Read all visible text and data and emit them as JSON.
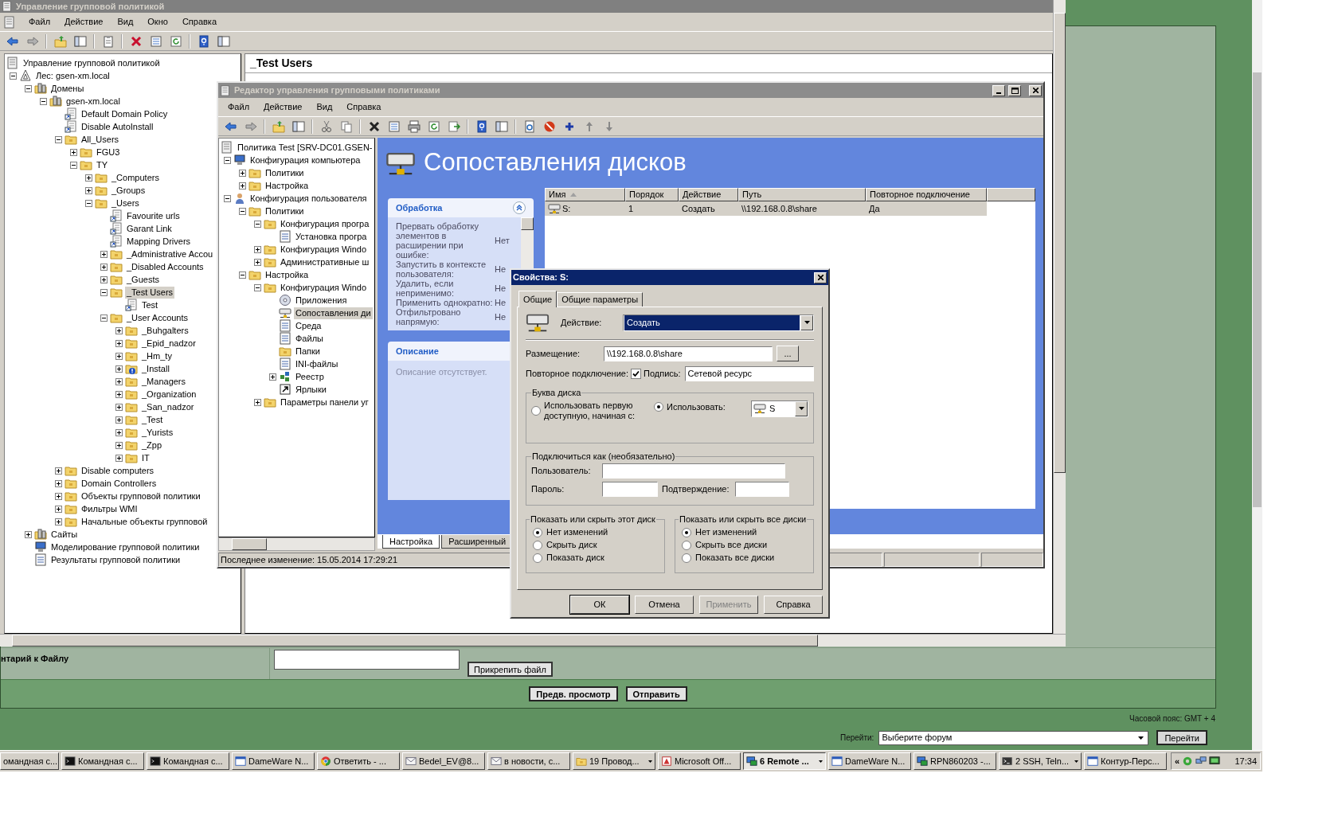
{
  "gpmc": {
    "title": "Управление групповой политикой",
    "menu": [
      "Файл",
      "Действие",
      "Вид",
      "Окно",
      "Справка"
    ],
    "details_title": "_Test Users",
    "tree": [
      {
        "label": "Управление групповой политикой",
        "kind": "console",
        "selected": false,
        "children": [
          {
            "label": "Лес: gsen-xm.local",
            "kind": "forest",
            "expanded": true,
            "selected": false,
            "children": [
              {
                "label": "Домены",
                "kind": "servers",
                "expanded": true,
                "selected": false,
                "children": [
                  {
                    "label": "gsen-xm.local",
                    "kind": "servers",
                    "expanded": true,
                    "selected": false,
                    "children": [
                      {
                        "label": "Default Domain Policy",
                        "kind": "gpo",
                        "selected": false
                      },
                      {
                        "label": "Disable AutoInstall",
                        "kind": "gpo",
                        "selected": false
                      },
                      {
                        "label": "All_Users",
                        "kind": "folder",
                        "expanded": true,
                        "selected": false,
                        "children": [
                          {
                            "label": "FGU3",
                            "kind": "folder",
                            "expanded": false,
                            "selected": false
                          },
                          {
                            "label": "TY",
                            "kind": "folder",
                            "expanded": true,
                            "selected": false,
                            "children": [
                              {
                                "label": "_Computers",
                                "kind": "folder",
                                "expanded": false,
                                "selected": false
                              },
                              {
                                "label": "_Groups",
                                "kind": "folder",
                                "expanded": false,
                                "selected": false
                              },
                              {
                                "label": "_Users",
                                "kind": "folder",
                                "expanded": true,
                                "selected": false,
                                "children": [
                                  {
                                    "label": "Favourite urls",
                                    "kind": "gpo",
                                    "selected": false
                                  },
                                  {
                                    "label": "Garant Link",
                                    "kind": "gpo",
                                    "selected": false
                                  },
                                  {
                                    "label": "Mapping Drivers",
                                    "kind": "gpo",
                                    "selected": false
                                  },
                                  {
                                    "label": "_Administrative Accou",
                                    "kind": "folder",
                                    "expanded": false,
                                    "selected": false
                                  },
                                  {
                                    "label": "_Disabled Accounts",
                                    "kind": "folder",
                                    "expanded": false,
                                    "selected": false
                                  },
                                  {
                                    "label": "_Guests",
                                    "kind": "folder",
                                    "expanded": false,
                                    "selected": false
                                  },
                                  {
                                    "label": "_Test Users",
                                    "kind": "folder",
                                    "expanded": true,
                                    "selected": true,
                                    "children": [
                                      {
                                        "label": "Test",
                                        "kind": "gpo",
                                        "selected": false
                                      }
                                    ]
                                  },
                                  {
                                    "label": "_User Accounts",
                                    "kind": "folder",
                                    "expanded": true,
                                    "selected": false,
                                    "children": [
                                      {
                                        "label": "_Buhgalters",
                                        "kind": "folder",
                                        "expanded": false,
                                        "selected": false
                                      },
                                      {
                                        "label": "_Epid_nadzor",
                                        "kind": "folder",
                                        "expanded": false,
                                        "selected": false
                                      },
                                      {
                                        "label": "_Hm_ty",
                                        "kind": "folder",
                                        "expanded": false,
                                        "selected": false
                                      },
                                      {
                                        "label": "_Install",
                                        "kind": "folder-alert",
                                        "expanded": false,
                                        "selected": false
                                      },
                                      {
                                        "label": "_Managers",
                                        "kind": "folder",
                                        "expanded": false,
                                        "selected": false
                                      },
                                      {
                                        "label": "_Organization",
                                        "kind": "folder",
                                        "expanded": false,
                                        "selected": false
                                      },
                                      {
                                        "label": "_San_nadzor",
                                        "kind": "folder",
                                        "expanded": false,
                                        "selected": false
                                      },
                                      {
                                        "label": "_Test",
                                        "kind": "folder",
                                        "expanded": false,
                                        "selected": false
                                      },
                                      {
                                        "label": "_Yurists",
                                        "kind": "folder",
                                        "expanded": false,
                                        "selected": false
                                      },
                                      {
                                        "label": "_Zpp",
                                        "kind": "folder",
                                        "expanded": false,
                                        "selected": false
                                      },
                                      {
                                        "label": "IT",
                                        "kind": "folder",
                                        "expanded": false,
                                        "selected": false
                                      }
                                    ]
                                  }
                                ]
                              }
                            ]
                          }
                        ]
                      },
                      {
                        "label": "Disable computers",
                        "kind": "folder",
                        "expanded": false,
                        "selected": false
                      },
                      {
                        "label": "Domain Controllers",
                        "kind": "folder",
                        "expanded": false,
                        "selected": false
                      },
                      {
                        "label": "Объекты групповой политики",
                        "kind": "folder",
                        "expanded": false,
                        "selected": false
                      },
                      {
                        "label": "Фильтры WMI",
                        "kind": "folder",
                        "expanded": false,
                        "selected": false
                      },
                      {
                        "label": "Начальные объекты групповой",
                        "kind": "folder",
                        "expanded": false,
                        "selected": false
                      }
                    ]
                  }
                ]
              },
              {
                "label": "Сайты",
                "kind": "servers",
                "expanded": false,
                "selected": false
              },
              {
                "label": "Моделирование групповой политики",
                "kind": "computer",
                "selected": false
              },
              {
                "label": "Результаты групповой политики",
                "kind": "doc",
                "selected": false
              }
            ]
          }
        ]
      }
    ]
  },
  "editor": {
    "title": "Редактор управления групповыми политиками",
    "menu": [
      "Файл",
      "Действие",
      "Вид",
      "Справка"
    ],
    "tree": [
      {
        "label": "Политика Test [SRV-DC01.GSEN-",
        "kind": "console",
        "selected": false,
        "children": [
          {
            "label": "Конфигурация компьютера",
            "kind": "computer",
            "expanded": true,
            "selected": false,
            "children": [
              {
                "label": "Политики",
                "kind": "folder",
                "expanded": false,
                "selected": false
              },
              {
                "label": "Настройка",
                "kind": "folder",
                "expanded": false,
                "selected": false
              }
            ]
          },
          {
            "label": "Конфигурация пользователя",
            "kind": "user",
            "expanded": true,
            "selected": false,
            "children": [
              {
                "label": "Политики",
                "kind": "folder",
                "expanded": true,
                "selected": false,
                "children": [
                  {
                    "label": "Конфигурация програ",
                    "kind": "folder",
                    "expanded": true,
                    "selected": false,
                    "children": [
                      {
                        "label": "Установка програ",
                        "kind": "doc",
                        "selected": false
                      }
                    ]
                  },
                  {
                    "label": "Конфигурация Windo",
                    "kind": "folder",
                    "expanded": false,
                    "selected": false
                  },
                  {
                    "label": "Административные ш",
                    "kind": "folder",
                    "expanded": false,
                    "selected": false
                  }
                ]
              },
              {
                "label": "Настройка",
                "kind": "folder",
                "expanded": true,
                "selected": false,
                "children": [
                  {
                    "label": "Конфигурация Windo",
                    "kind": "folder",
                    "expanded": true,
                    "selected": false,
                    "children": [
                      {
                        "label": "Приложения",
                        "kind": "disc",
                        "selected": false
                      },
                      {
                        "label": "Сопоставления ди",
                        "kind": "drive",
                        "selected": true
                      },
                      {
                        "label": "Среда",
                        "kind": "doc",
                        "selected": false
                      },
                      {
                        "label": "Файлы",
                        "kind": "doc",
                        "selected": false
                      },
                      {
                        "label": "Папки",
                        "kind": "folder",
                        "selected": false
                      },
                      {
                        "label": "INI-файлы",
                        "kind": "doc",
                        "selected": false
                      },
                      {
                        "label": "Реестр",
                        "kind": "registry",
                        "expanded": false,
                        "selected": false
                      },
                      {
                        "label": "Ярлыки",
                        "kind": "shortcut",
                        "selected": false
                      }
                    ]
                  },
                  {
                    "label": "Параметры панели уг",
                    "kind": "folder",
                    "expanded": false,
                    "selected": false
                  }
                ]
              }
            ]
          }
        ]
      }
    ],
    "heading": "Сопоставления дисков",
    "processing": {
      "title": "Обработка",
      "rows": [
        {
          "label": "Прервать обработку элементов в расширении при ошибке:",
          "value": "Нет"
        },
        {
          "label": "Запустить в контексте пользователя:",
          "value": "Не"
        },
        {
          "label": "Удалить, если неприменимо:",
          "value": "Не"
        },
        {
          "label": "Применить однократно:",
          "value": "Не"
        },
        {
          "label": "Отфильтровано напрямую:",
          "value": "Не"
        }
      ]
    },
    "description": {
      "title": "Описание",
      "text": "Описание отсутствует."
    },
    "table": {
      "columns": [
        {
          "label": "Имя",
          "sorted": true
        },
        {
          "label": "Порядок",
          "sorted": false
        },
        {
          "label": "Действие",
          "sorted": false
        },
        {
          "label": "Путь",
          "sorted": false
        },
        {
          "label": "Повторное подключение",
          "sorted": false
        }
      ],
      "rows": [
        {
          "cells": [
            "S:",
            "1",
            "Создать",
            "\\\\192.168.0.8\\share",
            "Да"
          ],
          "selected": true
        }
      ]
    },
    "tabs": [
      {
        "label": "Настройка",
        "selected": true
      },
      {
        "label": "Расширенный",
        "selected": false
      }
    ],
    "status": "Последнее изменение: 15.05.2014 17:29:21"
  },
  "dialog": {
    "title": "Свойства: S:",
    "tabs": [
      {
        "label": "Общие",
        "selected": true
      },
      {
        "label": "Общие параметры",
        "selected": false
      }
    ],
    "action": {
      "label": "Действие:",
      "value": "Создать"
    },
    "location": {
      "label": "Размещение:",
      "value": "\\\\192.168.0.8\\share",
      "browse": "..."
    },
    "reconnect": {
      "label": "Повторное подключение:",
      "checked": true
    },
    "caption": {
      "label": "Подпись:",
      "value": "Сетевой ресурс"
    },
    "drive_letter": {
      "title": "Буква диска",
      "options": [
        {
          "label": "Использовать первую доступную, начиная с:",
          "selected": false
        },
        {
          "label": "Использовать:",
          "selected": true
        }
      ],
      "letter": "S"
    },
    "connect_as": {
      "title": "Подключиться как (необязательно)",
      "user_label": "Пользователь:",
      "password_label": "Пароль:",
      "confirm_label": "Подтверждение:"
    },
    "show_this": {
      "title": "Показать или скрыть этот диск",
      "options": [
        {
          "label": "Нет изменений",
          "selected": true
        },
        {
          "label": "Скрыть диск",
          "selected": false
        },
        {
          "label": "Показать диск",
          "selected": false
        }
      ]
    },
    "show_all": {
      "title": "Показать или скрыть все диски",
      "options": [
        {
          "label": "Нет изменений",
          "selected": true
        },
        {
          "label": "Скрыть все диски",
          "selected": false
        },
        {
          "label": "Показать все диски",
          "selected": false
        }
      ]
    },
    "buttons": [
      {
        "label": "ОК",
        "default": true,
        "disabled": false
      },
      {
        "label": "Отмена",
        "default": false,
        "disabled": false
      },
      {
        "label": "Применить",
        "default": false,
        "disabled": true
      },
      {
        "label": "Справка",
        "default": false,
        "disabled": false
      }
    ]
  },
  "forum": {
    "comment_label": "нтарий к Файлу",
    "attach_button": "Прикрепить файл",
    "buttons": [
      "Предв. просмотр",
      "Отправить"
    ],
    "timezone": "Часовой пояс: GMT + 4",
    "jump_label": "Перейти:",
    "jump_select": "Выберите форум",
    "jump_button": "Перейти"
  },
  "taskbar": {
    "items": [
      {
        "label": "омандная с...",
        "grouped": false,
        "selected": false
      },
      {
        "label": "Командная с...",
        "kind": "console",
        "grouped": false,
        "selected": false
      },
      {
        "label": "Командная с...",
        "kind": "console",
        "grouped": false,
        "selected": false
      },
      {
        "label": "DameWare N...",
        "kind": "window",
        "grouped": false,
        "selected": false
      },
      {
        "label": "Ответить - ...",
        "kind": "browser",
        "grouped": false,
        "selected": false
      },
      {
        "label": "Bedel_EV@8...",
        "kind": "mail",
        "grouped": false,
        "selected": false
      },
      {
        "label": "в новости, с...",
        "kind": "mail",
        "grouped": false,
        "selected": false
      },
      {
        "label": "19 Провод...",
        "kind": "folder",
        "grouped": true,
        "selected": false
      },
      {
        "label": "Microsoft Off...",
        "kind": "office",
        "grouped": false,
        "selected": false
      },
      {
        "label": "6 Remote ...",
        "kind": "remote",
        "grouped": true,
        "selected": true
      },
      {
        "label": "DameWare N...",
        "kind": "window",
        "grouped": false,
        "selected": false
      },
      {
        "label": "RPN860203 -...",
        "kind": "remote",
        "grouped": false,
        "selected": false
      },
      {
        "label": "2 SSH, Teln...",
        "kind": "ssh",
        "grouped": true,
        "selected": false
      },
      {
        "label": "Контур-Перс...",
        "kind": "window",
        "grouped": false,
        "selected": false
      }
    ],
    "tray": {
      "expand": "«",
      "time": "17:34"
    }
  }
}
